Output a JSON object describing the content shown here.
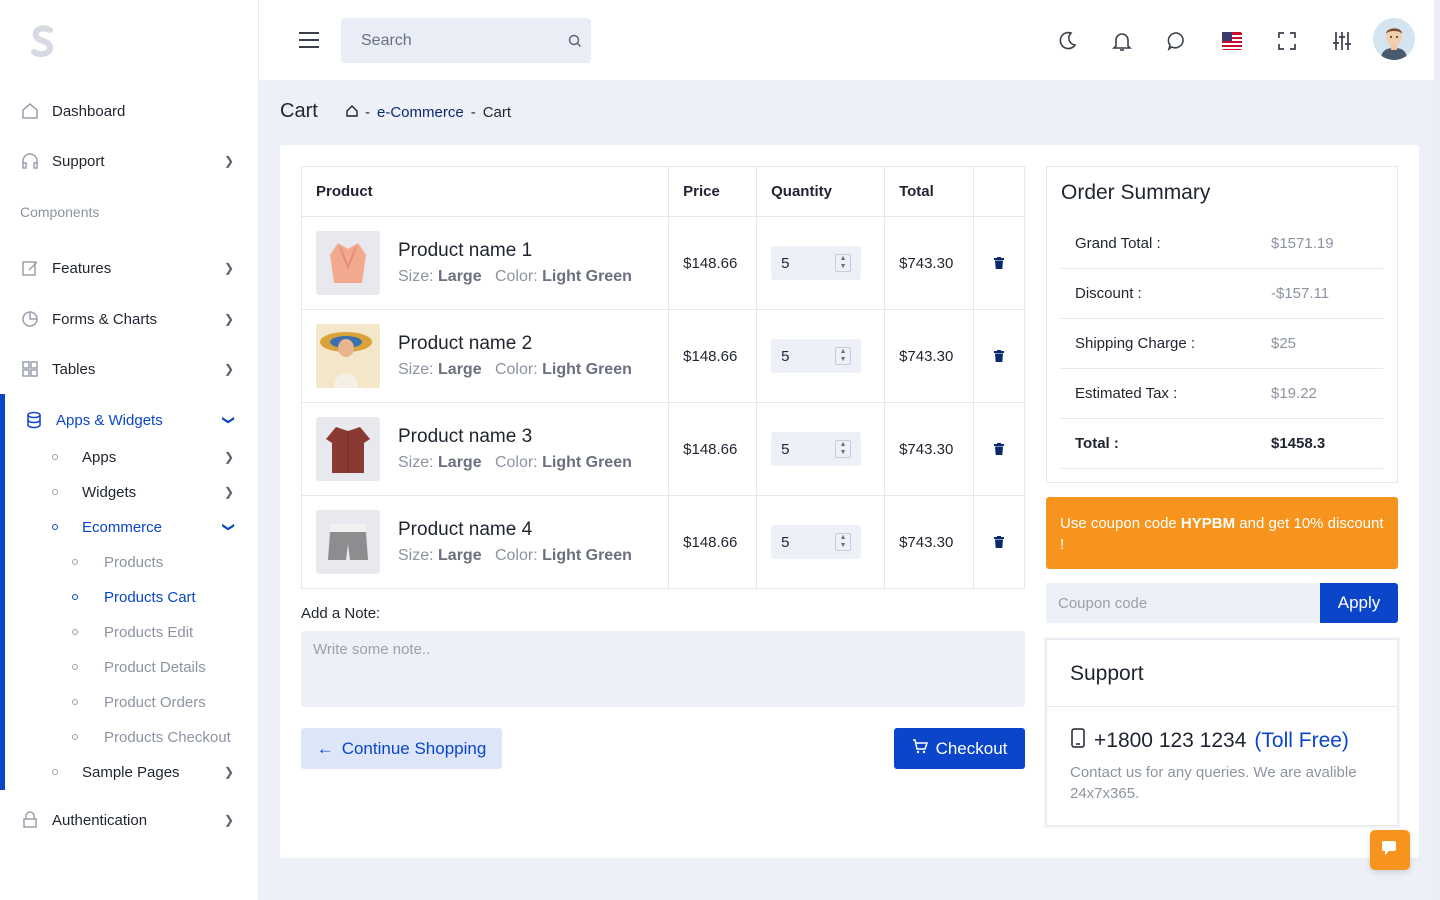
{
  "header": {
    "search_placeholder": "Search"
  },
  "sidebar": {
    "items": [
      {
        "label": "Dashboard"
      },
      {
        "label": "Support"
      },
      {
        "label": "Features"
      },
      {
        "label": "Forms & Charts"
      },
      {
        "label": "Tables"
      },
      {
        "label": "Apps & Widgets"
      },
      {
        "label": "Authentication"
      }
    ],
    "section_components": "Components",
    "sub_items": [
      {
        "label": "Apps"
      },
      {
        "label": "Widgets"
      },
      {
        "label": "Ecommerce"
      },
      {
        "label": "Sample Pages"
      }
    ],
    "ecommerce_items": [
      {
        "label": "Products"
      },
      {
        "label": "Products Cart"
      },
      {
        "label": "Products Edit"
      },
      {
        "label": "Product Details"
      },
      {
        "label": "Product Orders"
      },
      {
        "label": "Products Checkout"
      }
    ]
  },
  "page": {
    "title": "Cart",
    "breadcrumb": [
      "e-Commerce",
      "Cart"
    ],
    "separator": "-"
  },
  "cart": {
    "columns": [
      "Product",
      "Price",
      "Quantity",
      "Total"
    ],
    "size_label": "Size:",
    "color_label": "Color:",
    "rows": [
      {
        "name": "Product name 1",
        "size": "Large",
        "color": "Light Green",
        "price": "$148.66",
        "qty": "5",
        "total": "$743.30"
      },
      {
        "name": "Product name 2",
        "size": "Large",
        "color": "Light Green",
        "price": "$148.66",
        "qty": "5",
        "total": "$743.30"
      },
      {
        "name": "Product name 3",
        "size": "Large",
        "color": "Light Green",
        "price": "$148.66",
        "qty": "5",
        "total": "$743.30"
      },
      {
        "name": "Product name 4",
        "size": "Large",
        "color": "Light Green",
        "price": "$148.66",
        "qty": "5",
        "total": "$743.30"
      }
    ],
    "note_label": "Add a Note:",
    "note_placeholder": "Write some note..",
    "continue_label": "Continue Shopping",
    "checkout_label": "Checkout"
  },
  "summary": {
    "title": "Order Summary",
    "rows": [
      {
        "label": "Grand Total :",
        "value": "$1571.19"
      },
      {
        "label": "Discount :",
        "value": "-$157.11"
      },
      {
        "label": "Shipping Charge :",
        "value": "$25"
      },
      {
        "label": "Estimated Tax :",
        "value": "$19.22"
      },
      {
        "label": "Total :",
        "value": "$1458.3"
      }
    ]
  },
  "coupon": {
    "banner_prefix": "Use coupon code ",
    "code": "HYPBM",
    "banner_suffix": " and get 10% discount !",
    "input_placeholder": "Coupon code",
    "apply_label": "Apply"
  },
  "support": {
    "title": "Support",
    "phone": "+1800 123 1234",
    "toll": "(Toll Free)",
    "contact": "Contact us for any queries. We are avalible 24x7x365."
  },
  "colors": {
    "primary": "#0b45c9",
    "accent": "#f7941d",
    "background": "#edf0f7"
  }
}
